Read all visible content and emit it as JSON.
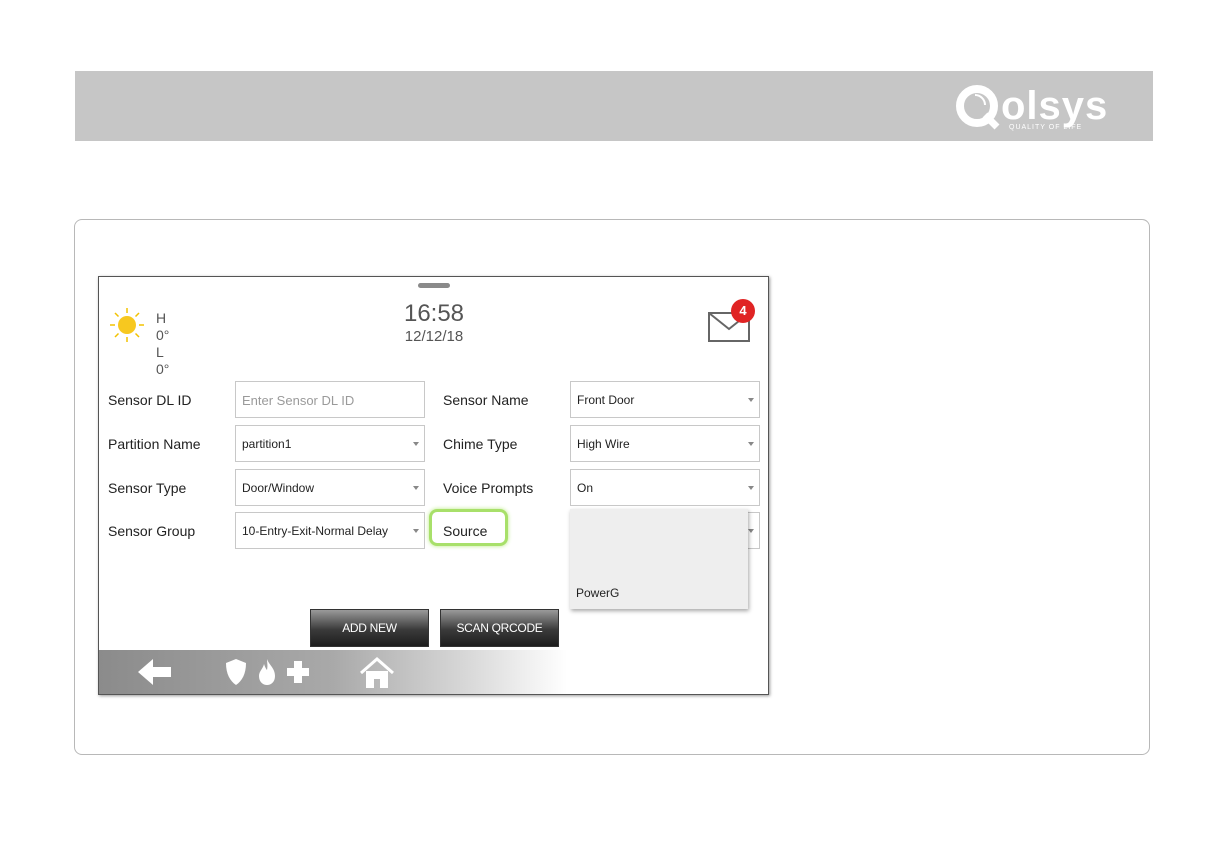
{
  "brand": {
    "name": "olsys",
    "tagline": "QUALITY OF LIFE"
  },
  "weather": {
    "high": "H 0°",
    "low": "L 0°",
    "icon": "sun-icon"
  },
  "clock": {
    "time": "16:58",
    "date": "12/12/18"
  },
  "messages": {
    "count": "4",
    "icon": "mail-icon"
  },
  "form": {
    "sensor_dl_id": {
      "label": "Sensor DL ID",
      "placeholder": "Enter Sensor DL ID"
    },
    "partition_name": {
      "label": "Partition Name",
      "value": "partition1"
    },
    "sensor_type": {
      "label": "Sensor Type",
      "value": "Door/Window"
    },
    "sensor_group": {
      "label": "Sensor Group",
      "value": "10-Entry-Exit-Normal Delay"
    },
    "sensor_name": {
      "label": "Sensor Name",
      "value": "Front Door"
    },
    "chime_type": {
      "label": "Chime Type",
      "value": "High Wire"
    },
    "voice_prompts": {
      "label": "Voice Prompts",
      "value": "On"
    },
    "source": {
      "label": "Source",
      "options": [
        "PowerG"
      ]
    }
  },
  "buttons": {
    "add_new": "ADD NEW",
    "scan_qrcode": "SCAN QRCODE"
  },
  "nav": {
    "icons": [
      "back-arrow-icon",
      "shield-icon",
      "flame-icon",
      "plus-icon",
      "home-icon"
    ]
  },
  "colors": {
    "highlight": "#a8e06a",
    "badge": "#e02424",
    "header_bar": "#c6c6c6"
  }
}
